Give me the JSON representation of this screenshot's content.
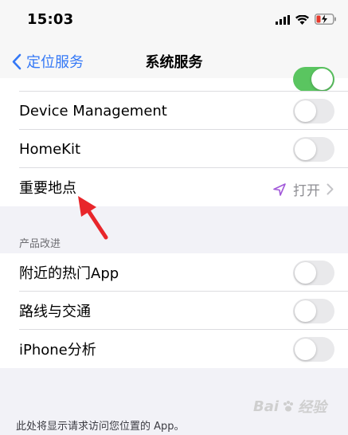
{
  "status_bar": {
    "time": "15:03",
    "battery_color": "#e5392b"
  },
  "nav": {
    "back_label": "定位服务",
    "title": "系统服务"
  },
  "group1": {
    "partial_row_toggle": "on",
    "rows": [
      {
        "label": "Device Management",
        "toggle": "off"
      },
      {
        "label": "HomeKit",
        "toggle": "off"
      },
      {
        "label": "重要地点",
        "value": "打开",
        "icon": "location-arrow-icon"
      }
    ]
  },
  "product_section": {
    "header": "产品改进",
    "rows": [
      {
        "label": "附近的热门App",
        "toggle": "off"
      },
      {
        "label": "路线与交通",
        "toggle": "off"
      },
      {
        "label": "iPhone分析",
        "toggle": "off"
      }
    ]
  },
  "footer": {
    "note": "此处将显示请求访问您位置的 App。"
  },
  "watermark": {
    "brand": "Bai",
    "suffix": "经验"
  },
  "accent_color": "#3478f6",
  "annotation_arrow_color": "#e8262b"
}
